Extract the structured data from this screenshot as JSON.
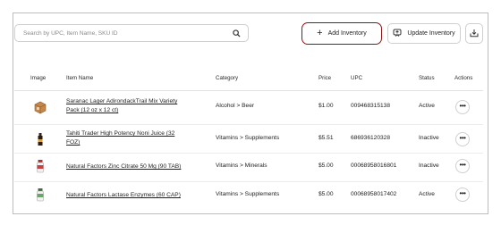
{
  "toolbar": {
    "search_placeholder": "Search by UPC, Item Name, SKU ID",
    "add_label": "Add Inventory",
    "update_label": "Update Inventory"
  },
  "table": {
    "headers": {
      "image": "Image",
      "item_name": "Item Name",
      "category": "Category",
      "price": "Price",
      "upc": "UPC",
      "status": "Status",
      "actions": "Actions"
    },
    "rows": [
      {
        "name_line1": "Saranac Lager AdirondackTrail Mix Variety",
        "name_line2": "Pack (12 oz x 12 ct)",
        "category": "Alcohol > Beer",
        "price": "$1.00",
        "upc": "009468315138",
        "status": "Active",
        "actions": "•••",
        "thumb_icon": "beer-pack-icon"
      },
      {
        "name_line1": "Tahiti Trader High Potency Noni Juice (32",
        "name_line2": "FOZ)",
        "category": "Vitamins > Supplements",
        "price": "$5.51",
        "upc": "686936120328",
        "status": "Inactive",
        "actions": "•••",
        "thumb_icon": "juice-bottle-icon"
      },
      {
        "name_line1": "Natural Factors Zinc Citrate 50 Mg (90 TAB)",
        "name_line2": "",
        "category": "Vitamins > Minerals",
        "price": "$5.00",
        "upc": "00068958016801",
        "status": "Inactive",
        "actions": "•••",
        "thumb_icon": "supplement-bottle-icon"
      },
      {
        "name_line1": "Natural Factors Lactase Enzymes (60 CAP)",
        "name_line2": "",
        "category": "Vitamins > Supplements",
        "price": "$5.00",
        "upc": "00068958017402",
        "status": "Active",
        "actions": "•••",
        "thumb_icon": "capsule-bottle-icon"
      }
    ]
  },
  "colors": {
    "add_button_border": "#8b1515",
    "border": "#cfcfcf"
  }
}
